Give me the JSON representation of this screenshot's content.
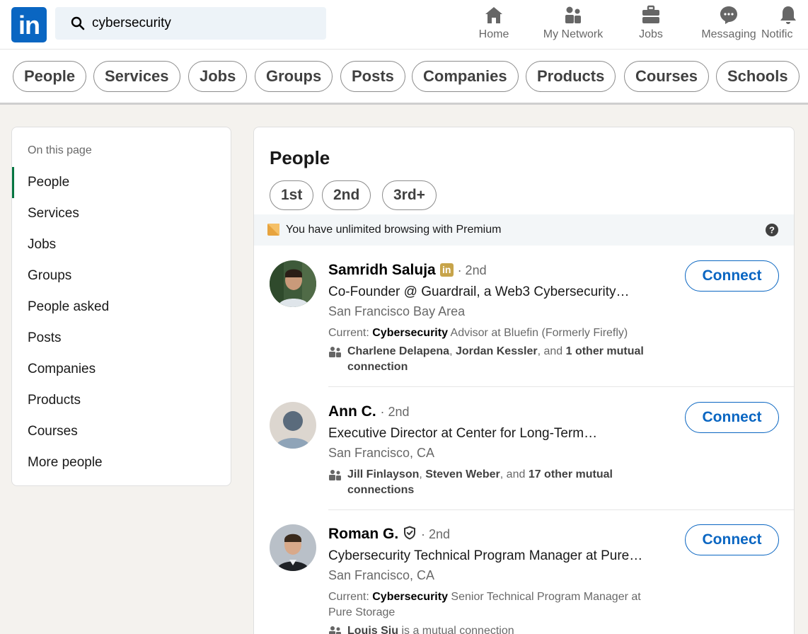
{
  "search": {
    "value": "cybersecurity"
  },
  "nav": [
    {
      "label": "Home",
      "icon": "home-icon"
    },
    {
      "label": "My Network",
      "icon": "network-icon"
    },
    {
      "label": "Jobs",
      "icon": "jobs-icon"
    },
    {
      "label": "Messaging",
      "icon": "messaging-icon"
    },
    {
      "label": "Notific",
      "icon": "notifications-icon"
    }
  ],
  "filters": [
    "People",
    "Services",
    "Jobs",
    "Groups",
    "Posts",
    "Companies",
    "Products",
    "Courses",
    "Schools"
  ],
  "sidebar": {
    "heading": "On this page",
    "items": [
      "People",
      "Services",
      "Jobs",
      "Groups",
      "People asked",
      "Posts",
      "Companies",
      "Products",
      "Courses",
      "More people"
    ],
    "active": "People"
  },
  "main": {
    "title": "People",
    "degrees": [
      "1st",
      "2nd",
      "3rd+"
    ],
    "premium_text": "You have unlimited browsing with Premium",
    "connect_label": "Connect",
    "people": [
      {
        "name": "Samridh Saluja",
        "badge": "in",
        "degree": "· 2nd",
        "headline": "Co-Founder @ Guardrail, a Web3 Cybersecurity…",
        "location": "San Francisco Bay Area",
        "current_prefix": "Current: ",
        "current_bold": "Cybersecurity",
        "current_rest": " Advisor at Bluefin (Formerly Firefly)",
        "mutual_bold_1": "Charlene Delapena",
        "mutual_sep_1": ", ",
        "mutual_bold_2": "Jordan Kessler",
        "mutual_sep_2": ", and ",
        "mutual_bold_3": "1 other mutual",
        "mutual_tail": "connection"
      },
      {
        "name": "Ann C.",
        "degree": "· 2nd",
        "headline": "Executive Director at Center for Long-Term…",
        "location": "San Francisco, CA",
        "mutual_bold_1": "Jill Finlayson",
        "mutual_sep_1": ", ",
        "mutual_bold_2": "Steven Weber",
        "mutual_sep_2": ", and ",
        "mutual_bold_3": "17 other mutual",
        "mutual_tail": "connections"
      },
      {
        "name": "Roman G.",
        "degree": "· 2nd",
        "headline": "Cybersecurity Technical Program Manager at Pure…",
        "location": "San Francisco, CA",
        "current_prefix": "Current: ",
        "current_bold": "Cybersecurity",
        "current_rest": " Senior Technical Program Manager at Pure Storage",
        "mutual_bold_1": "Louis Siu",
        "mutual_rest": " is a mutual connection"
      }
    ]
  },
  "colors": {
    "brand": "#0a66c2",
    "active_marker": "#057642",
    "premium": "#e7a33e"
  }
}
